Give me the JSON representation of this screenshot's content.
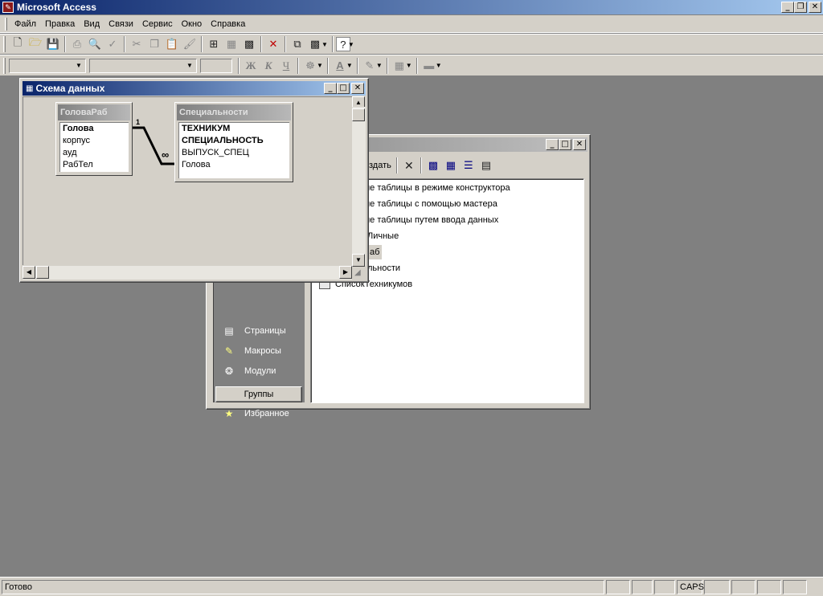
{
  "app": {
    "title": "Microsoft Access"
  },
  "menu": [
    "Файл",
    "Правка",
    "Вид",
    "Связи",
    "Сервис",
    "Окно",
    "Справка"
  ],
  "format_toolbar": {
    "bold": "Ж",
    "italic": "К",
    "underline": "Ч",
    "font_color_letter": "A"
  },
  "db_window": {
    "toolbar": {
      "create_label": "оздать"
    },
    "list_items": [
      "ие таблицы в режиме конструктора",
      "ие таблицы с помощью мастера",
      "ие таблицы путем ввода данных",
      "Личные",
      "аб",
      "льности",
      "СписокТехникумов"
    ],
    "sidebar_items": [
      "Страницы",
      "Макросы",
      "Модули"
    ],
    "groups_label": "Группы",
    "favorites_label": "Избранное"
  },
  "schema_window": {
    "title": "Схема данных",
    "tables": [
      {
        "name": "ГоловаРаб",
        "fields": [
          {
            "name": "Голова",
            "key": true
          },
          {
            "name": "корпус",
            "key": false
          },
          {
            "name": "ауд",
            "key": false
          },
          {
            "name": "РабТел",
            "key": false
          }
        ]
      },
      {
        "name": "Специальности",
        "fields": [
          {
            "name": "ТЕХНИКУМ",
            "key": true
          },
          {
            "name": "СПЕЦИАЛЬНОСТЬ",
            "key": true
          },
          {
            "name": "ВЫПУСК_СПЕЦ",
            "key": false
          },
          {
            "name": "Голова",
            "key": false
          }
        ]
      }
    ],
    "relation": {
      "one_label": "1",
      "many_label": "∞"
    }
  },
  "status": {
    "text": "Готово",
    "caps": "CAPS"
  },
  "colors": {
    "title_active": "#0a246a",
    "title_inactive": "#808080",
    "desktop": "#808080",
    "face": "#d4d0c8"
  }
}
